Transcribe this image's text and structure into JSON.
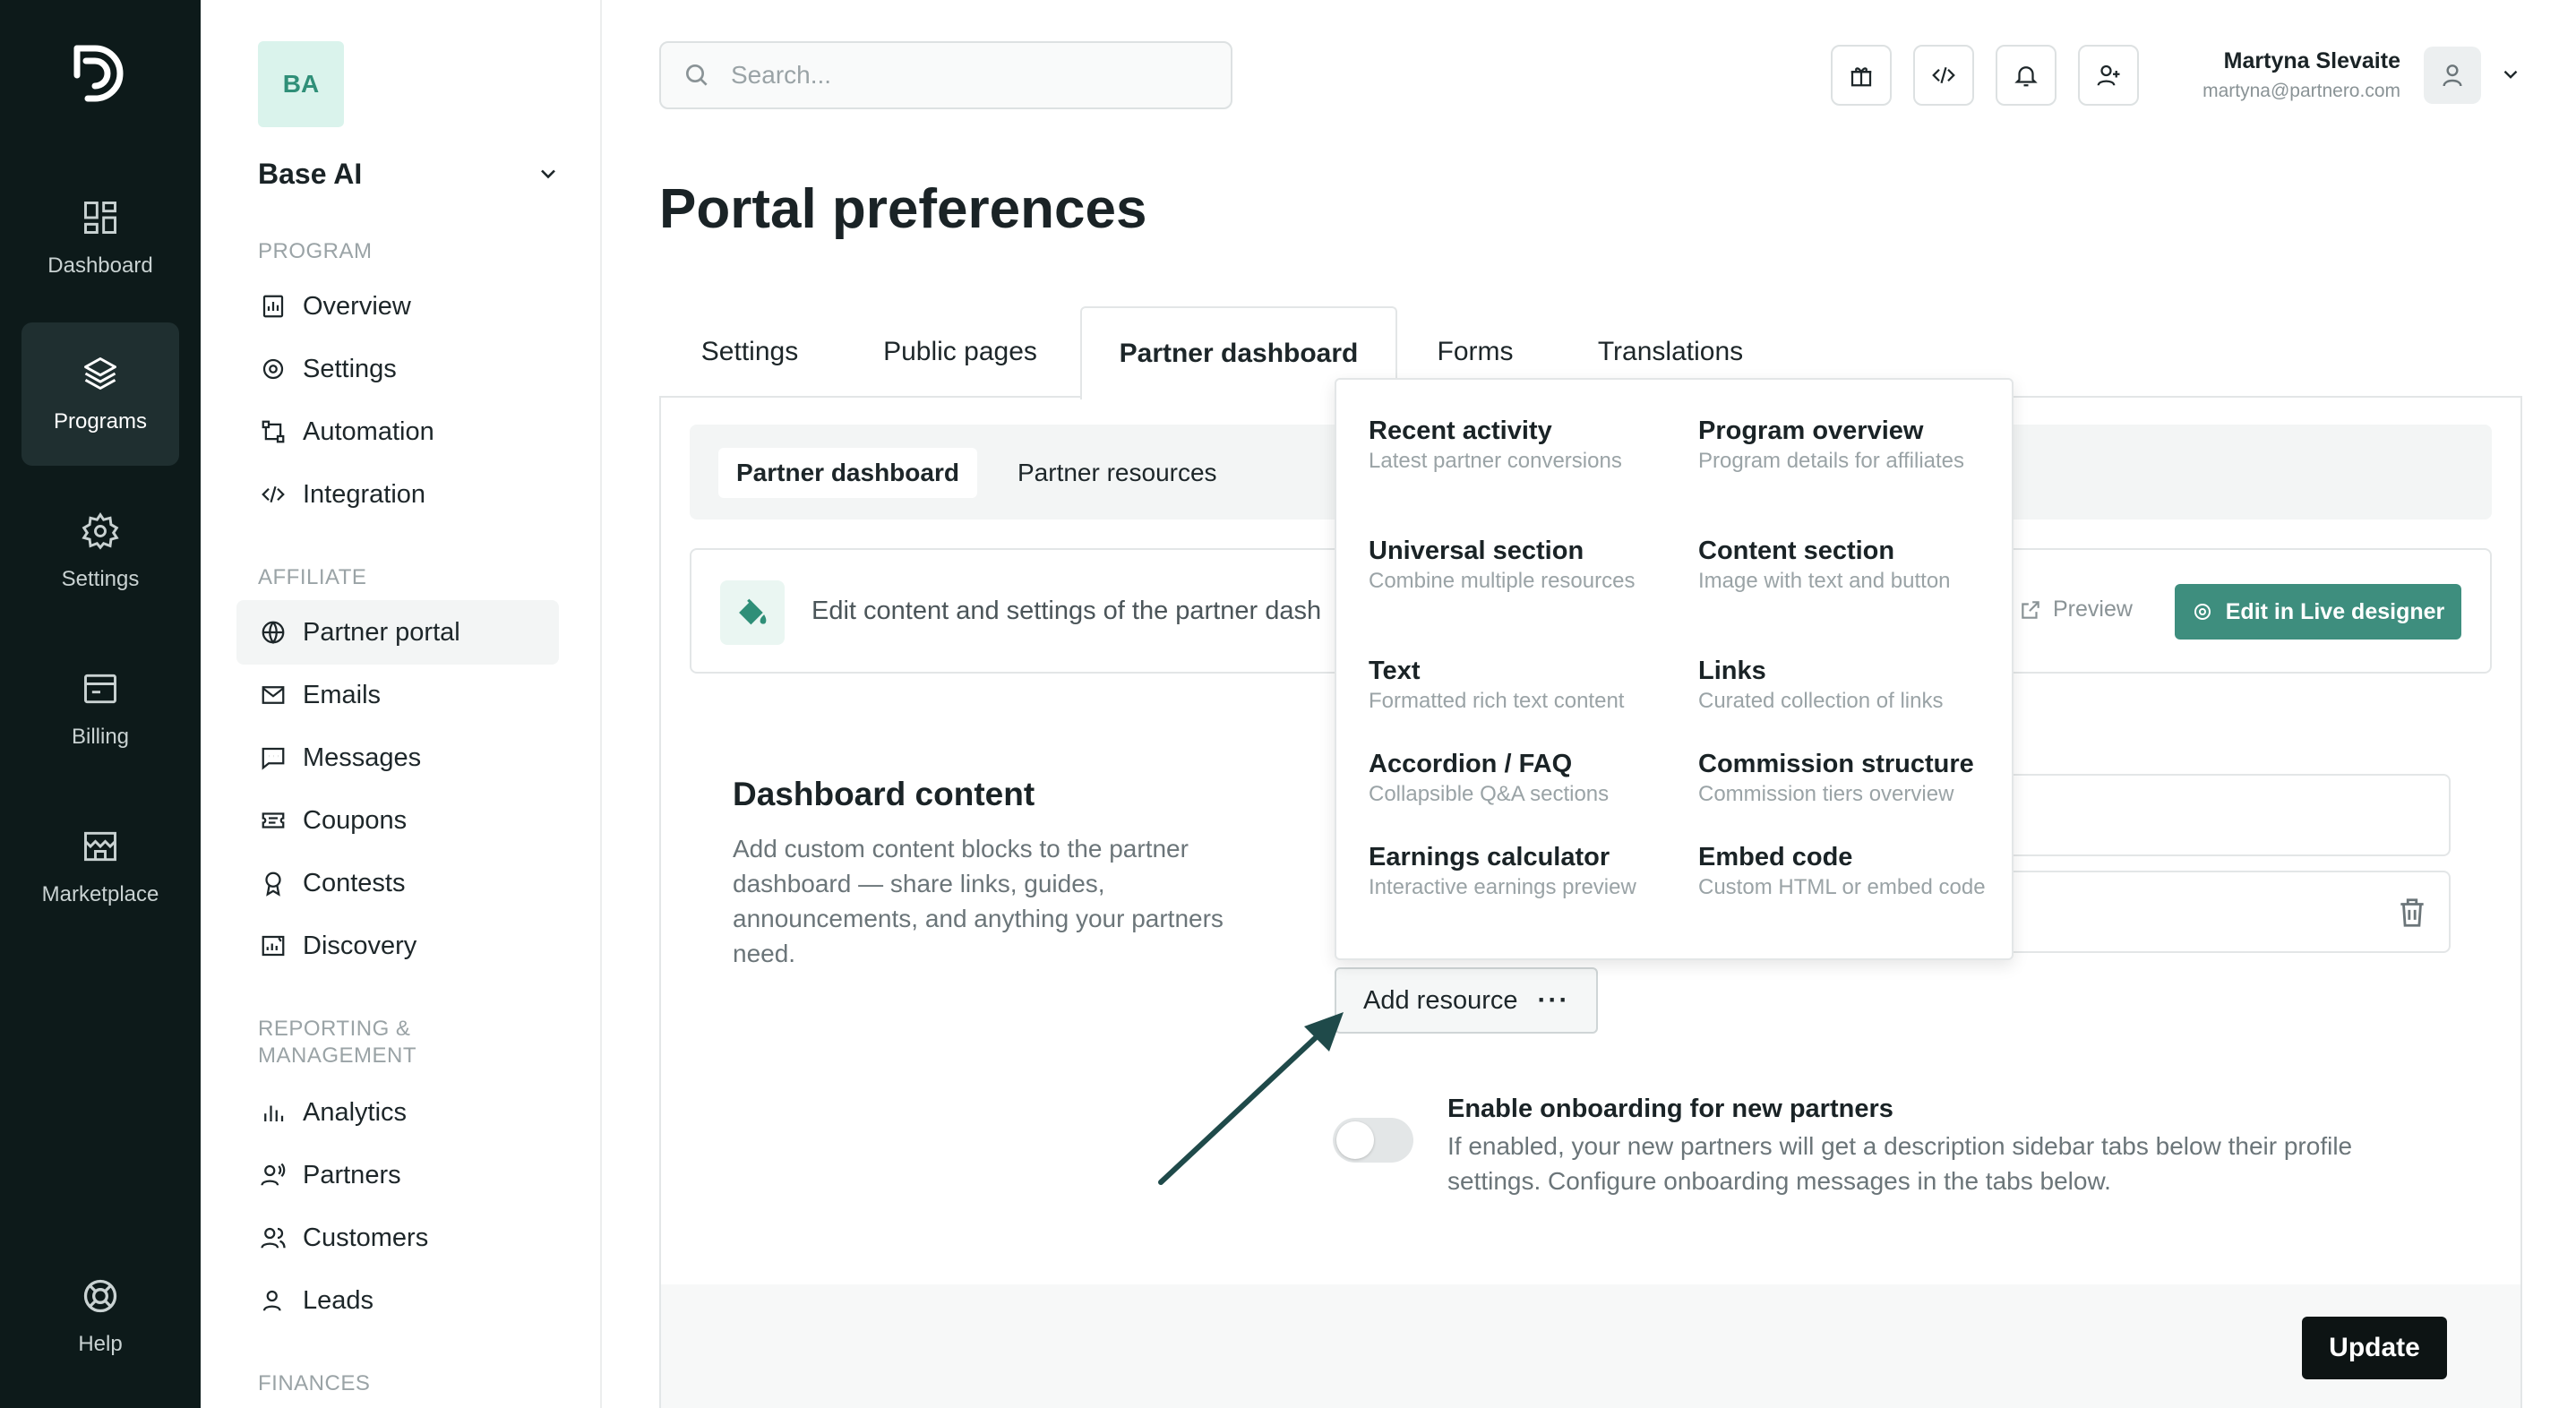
{
  "rail": {
    "items": [
      {
        "label": "Dashboard"
      },
      {
        "label": "Programs"
      },
      {
        "label": "Settings"
      },
      {
        "label": "Billing"
      },
      {
        "label": "Marketplace"
      },
      {
        "label": "Help"
      }
    ]
  },
  "sidebar": {
    "workspace_badge": "BA",
    "workspace_name": "Base AI",
    "sections": {
      "program": "PROGRAM",
      "affiliate": "AFFILIATE",
      "reporting": "REPORTING &\nMANAGEMENT",
      "finances": "FINANCES"
    },
    "items": [
      {
        "label": "Overview"
      },
      {
        "label": "Settings"
      },
      {
        "label": "Automation"
      },
      {
        "label": "Integration"
      },
      {
        "label": "Partner portal"
      },
      {
        "label": "Emails"
      },
      {
        "label": "Messages"
      },
      {
        "label": "Coupons"
      },
      {
        "label": "Contests"
      },
      {
        "label": "Discovery"
      },
      {
        "label": "Analytics"
      },
      {
        "label": "Partners"
      },
      {
        "label": "Customers"
      },
      {
        "label": "Leads"
      }
    ]
  },
  "header": {
    "search_placeholder": "Search...",
    "user_name": "Martyna Slevaite",
    "user_email": "martyna@partnero.com"
  },
  "page": {
    "title": "Portal preferences",
    "tabs": [
      {
        "label": "Settings"
      },
      {
        "label": "Public pages"
      },
      {
        "label": "Partner dashboard"
      },
      {
        "label": "Forms"
      },
      {
        "label": "Translations"
      }
    ],
    "subtabs": [
      {
        "label": "Partner dashboard"
      },
      {
        "label": "Partner resources"
      }
    ],
    "info_text": "Edit content and settings of the partner dash",
    "preview_label": "Preview",
    "live_designer_label": "Edit in Live designer",
    "dashboard_content": {
      "title": "Dashboard content",
      "description": "Add custom content blocks to the partner dashboard — share links, guides, announcements, and anything your partners need."
    },
    "add_resource_label": "Add resource",
    "add_resource_more": "···",
    "onboarding": {
      "title": "Enable onboarding for new partners",
      "description": "If enabled, your new partners will get a description sidebar tabs below their profile settings. Configure onboarding messages in the tabs below.",
      "enabled": false
    },
    "update_label": "Update"
  },
  "dropdown": {
    "items": [
      {
        "title": "Recent activity",
        "desc": "Latest partner conversions"
      },
      {
        "title": "Program overview",
        "desc": "Program details for affiliates"
      },
      {
        "title": "Universal section",
        "desc": "Combine multiple resources"
      },
      {
        "title": "Content section",
        "desc": "Image with text and button"
      },
      {
        "title": "Text",
        "desc": "Formatted rich text content"
      },
      {
        "title": "Links",
        "desc": "Curated collection of links"
      },
      {
        "title": "Accordion / FAQ",
        "desc": "Collapsible Q&A sections"
      },
      {
        "title": "Commission structure",
        "desc": "Commission tiers overview"
      },
      {
        "title": "Earnings calculator",
        "desc": "Interactive earnings preview"
      },
      {
        "title": "Embed code",
        "desc": "Custom HTML or embed code"
      }
    ]
  },
  "colors": {
    "rail_bg": "#0d1a1a",
    "accent": "#3e8e7e",
    "primary_button": "#0d1414"
  }
}
